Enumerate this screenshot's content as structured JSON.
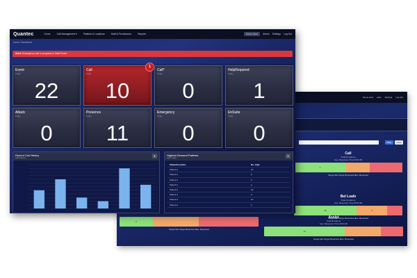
{
  "back_screen": {
    "nav": [
      "Demo User",
      "Help",
      "Settings",
      "Log Out"
    ],
    "buttons": [
      "Filter",
      "Clear"
    ],
    "widgets": [
      {
        "title": "Call",
        "sub1": "Total 64 Alarms",
        "sub2": "Avg. Response Time 00:02:05",
        "segments": [
          {
            "label": "4",
            "pct": 48,
            "color": "g"
          },
          {
            "label": "",
            "pct": 22,
            "color": "o"
          },
          {
            "label": "",
            "pct": 30,
            "color": "r"
          }
        ],
        "legend": "Target Met  Target Breached  Max. Breached"
      },
      {
        "title": "Bet Leafe",
        "sub1": "Total 44 Alarms",
        "sub2": "Avg. Response Time 00:02:06",
        "segments": [
          {
            "label": "60",
            "pct": 58,
            "color": "g"
          },
          {
            "label": "3",
            "pct": 28,
            "color": "o"
          },
          {
            "label": "",
            "pct": 14,
            "color": "r"
          }
        ],
        "legend": "Target Met  Target Breached  Max. Breached"
      },
      {
        "title": "",
        "sub1": "",
        "sub2": "",
        "segments": [
          {
            "label": "5",
            "pct": 24,
            "color": "g"
          },
          {
            "label": "",
            "pct": 33,
            "color": "o"
          },
          {
            "label": "",
            "pct": 43,
            "color": "r"
          }
        ],
        "legend": "Target Met  Target Breached  Max. Breached"
      },
      {
        "title": "Assist",
        "sub1": "Total 30 Alarms",
        "sub2": "Avg. Response Time 00:02:20",
        "segments": [
          {
            "label": "10",
            "pct": 58,
            "color": "g"
          },
          {
            "label": "",
            "pct": 26,
            "color": "o"
          },
          {
            "label": "",
            "pct": 16,
            "color": "r"
          }
        ],
        "legend": "Target Met  Target Breached  Max. Breached"
      }
    ]
  },
  "front_screen": {
    "brand": "Quantec",
    "menu": [
      "Home",
      "Call Management ▾",
      "Patients & Locations",
      "Staff & Permissions",
      "Reports"
    ],
    "right_nav": {
      "emergency": "Demo User",
      "user": "Admin",
      "settings": "Settings",
      "logout": "Log Out"
    },
    "breadcrumb": "Home / Dashboard",
    "alert": {
      "prefix": "Alert:",
      "text": " Emergency call in progress in Staff Room"
    },
    "tiles": [
      {
        "name": "Event",
        "sub": "Today",
        "value": "22",
        "alarm": false
      },
      {
        "name": "Call",
        "sub": "Today",
        "value": "10",
        "alarm": true,
        "badge": "1"
      },
      {
        "name": "Call*",
        "sub": "Today",
        "value": "0",
        "alarm": false
      },
      {
        "name": "HelpRequired",
        "sub": "Today",
        "value": "1",
        "alarm": false
      },
      {
        "name": "Attack",
        "sub": "Today",
        "value": "0",
        "alarm": false
      },
      {
        "name": "Presence",
        "sub": "Today",
        "value": "11",
        "alarm": false
      },
      {
        "name": "Emergency",
        "sub": "Today",
        "value": "0",
        "alarm": false
      },
      {
        "name": "EnSuite",
        "sub": "Today",
        "value": "0",
        "alarm": false
      }
    ],
    "history": {
      "title": "Recent Call History",
      "sub": "Last 6 Hours",
      "button": "▾"
    },
    "demand": {
      "title": "Highest Demand Patients",
      "sub": "Last 7 Days",
      "button": "▾",
      "headers": [
        "Patient/Location",
        "No. Calls"
      ],
      "rows": [
        [
          "Patient A",
          "10"
        ],
        [
          "Patient A",
          "6"
        ],
        [
          "Patient A",
          "4"
        ],
        [
          "Patient A",
          "3"
        ],
        [
          "Patient A",
          "10"
        ],
        [
          "Patient A",
          "2"
        ],
        [
          "Patient A",
          "10"
        ],
        [
          "Patient A",
          "2"
        ]
      ]
    }
  },
  "chart_data": {
    "type": "bar",
    "title": "Recent Call History",
    "categories": [
      "1",
      "2",
      "3",
      "4",
      "5",
      "6"
    ],
    "values": [
      5,
      8,
      3,
      2,
      11,
      6.5
    ],
    "ylim": [
      0,
      12
    ],
    "colors": {
      "bar": "#7ab3ee",
      "grid": "#2a3568"
    }
  }
}
